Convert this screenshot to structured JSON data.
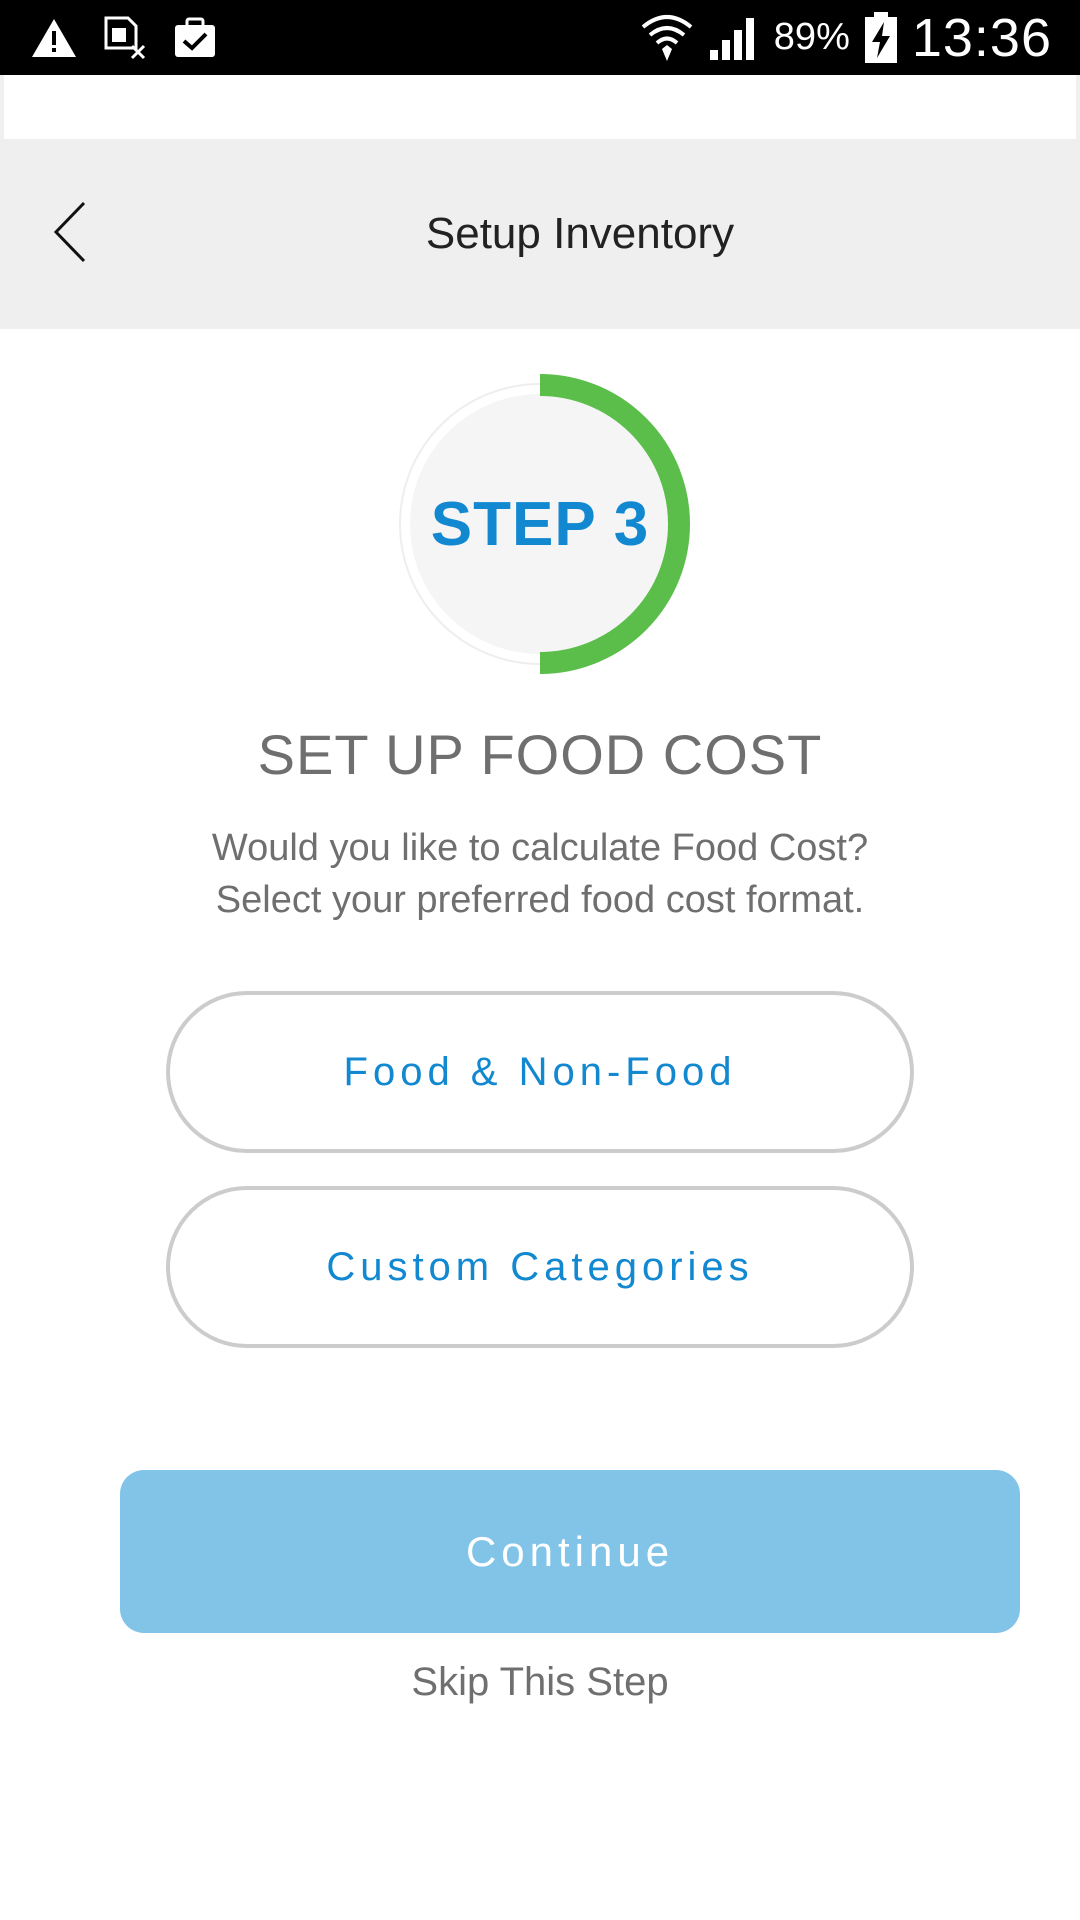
{
  "status_bar": {
    "icons": [
      "warning-icon",
      "sim-off-icon",
      "clipboard-check-icon",
      "wifi-icon",
      "signal-icon",
      "battery-charging-icon"
    ],
    "battery_percent": "89%",
    "clock": "13:36"
  },
  "header": {
    "title": "Setup Inventory",
    "back_icon": "chevron-left-icon"
  },
  "step": {
    "label": "STEP 3",
    "progress": 0.5,
    "progress_color": "#5bbd4a",
    "track_color": "#f0f0f0"
  },
  "content": {
    "title": "SET UP FOOD COST",
    "description_line1": "Would you like to calculate Food Cost?",
    "description_line2": "Select your preferred food cost format."
  },
  "options": [
    {
      "label": "Food & Non-Food"
    },
    {
      "label": "Custom Categories"
    }
  ],
  "actions": {
    "continue_label": "Continue",
    "skip_label": "Skip This Step"
  },
  "colors": {
    "accent": "#1188d0",
    "continue_bg": "#81c4e8",
    "header_bg": "#efefef"
  }
}
